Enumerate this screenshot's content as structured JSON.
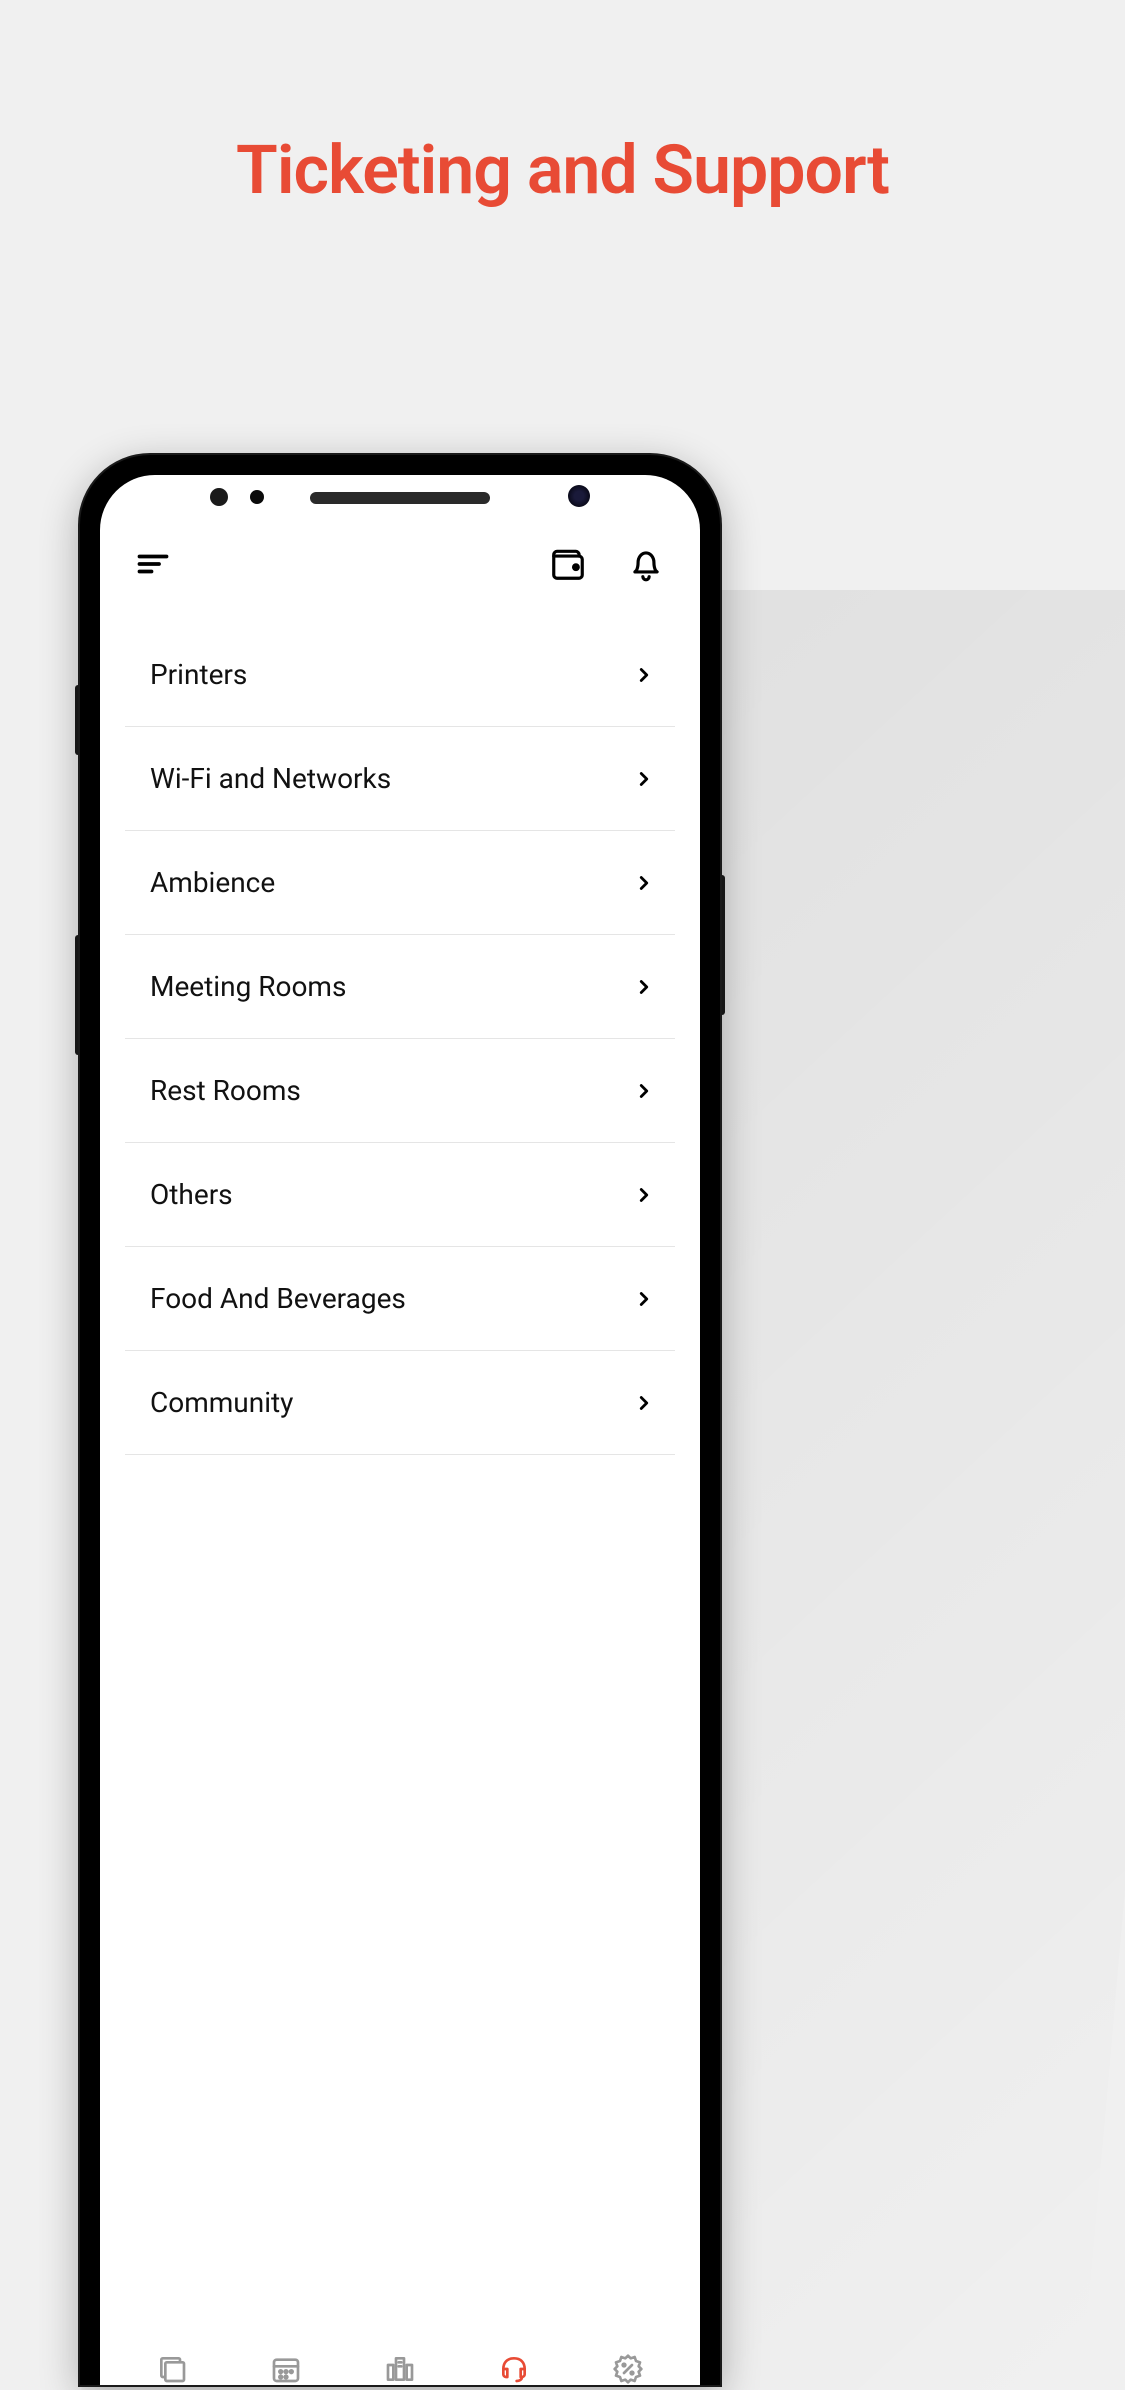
{
  "page": {
    "title": "Ticketing and Support"
  },
  "header": {
    "icons": {
      "menu": "menu-icon",
      "wallet": "wallet-icon",
      "bell": "bell-icon"
    }
  },
  "list": {
    "items": [
      {
        "label": "Printers"
      },
      {
        "label": "Wi-Fi and Networks"
      },
      {
        "label": "Ambience"
      },
      {
        "label": "Meeting Rooms"
      },
      {
        "label": "Rest Rooms"
      },
      {
        "label": "Others"
      },
      {
        "label": "Food And Beverages"
      },
      {
        "label": "Community"
      }
    ]
  },
  "bottom_nav": {
    "items": [
      {
        "name": "home",
        "active": false
      },
      {
        "name": "calendar",
        "active": false
      },
      {
        "name": "building",
        "active": false
      },
      {
        "name": "support",
        "active": true
      },
      {
        "name": "deals",
        "active": false
      }
    ],
    "active_color": "#e84b35",
    "inactive_color": "#999"
  }
}
